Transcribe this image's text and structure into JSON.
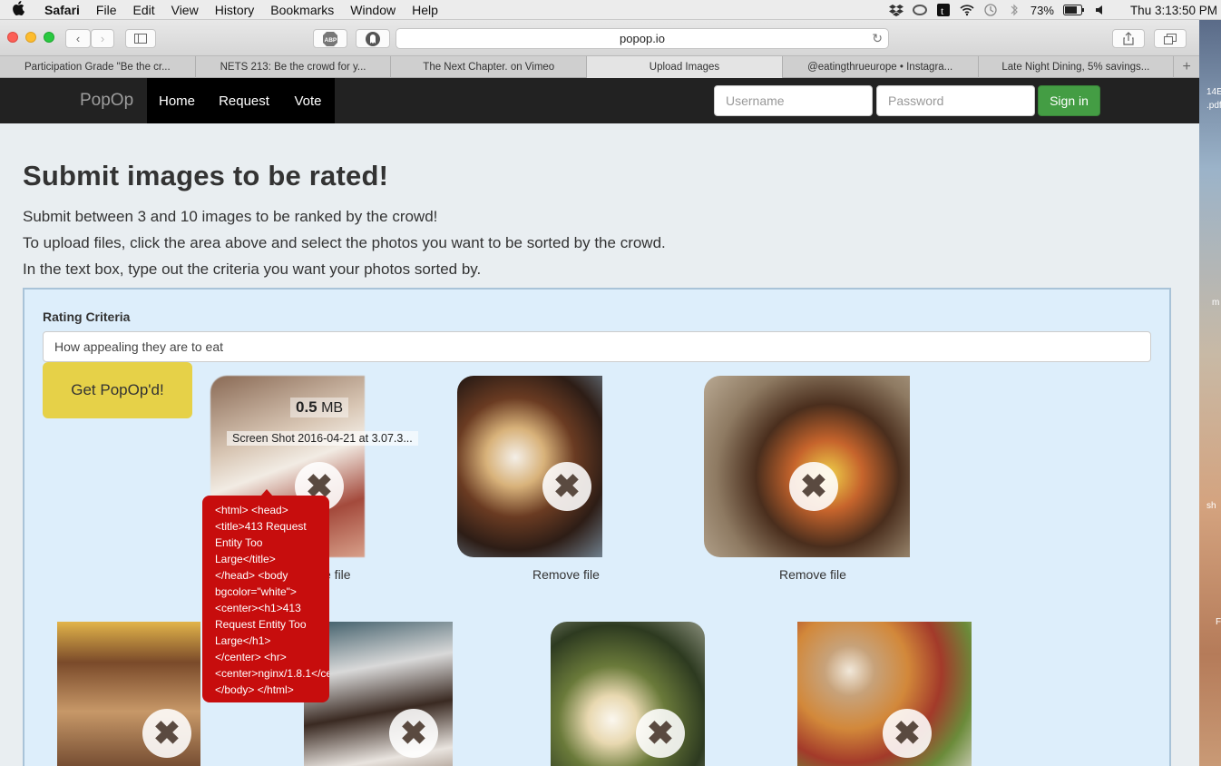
{
  "menubar": {
    "apple": "",
    "items": [
      "Safari",
      "File",
      "Edit",
      "View",
      "History",
      "Bookmarks",
      "Window",
      "Help"
    ],
    "battery": "73%",
    "clock": "Thu 3:13:50 PM"
  },
  "browser": {
    "url": "popop.io",
    "tabs": [
      "Participation Grade \"Be the cr...",
      "NETS 213: Be the crowd for y...",
      "The Next Chapter. on Vimeo",
      "Upload Images",
      "@eatingthrueurope • Instagra...",
      "Late Night Dining, 5% savings..."
    ],
    "active_tab_index": 3
  },
  "navbar": {
    "brand": "PopOp",
    "links": [
      "Home",
      "Request",
      "Vote"
    ],
    "username_placeholder": "Username",
    "password_placeholder": "Password",
    "signin_label": "Sign in"
  },
  "page": {
    "title": "Submit images to be rated!",
    "instructions": [
      "Submit between 3 and 10 images to be ranked by the crowd!",
      "To upload files, click the area above and select the photos you want to be sorted by the crowd.",
      "In the text box, type out the criteria you want your photos sorted by."
    ],
    "criteria_label": "Rating Criteria",
    "criteria_value": "How appealing they are to eat",
    "submit_label": "Get PopOp'd!",
    "remove_label": "Remove file",
    "remove_label_partial": "e file",
    "remove_glyph": "✖",
    "file1": {
      "size_value": "0.5",
      "size_unit": " MB",
      "name": "Screen Shot 2016-04-21 at 3.07.3..."
    },
    "error_message": "<html> <head> <title>413 Request Entity Too Large</title> </head> <body bgcolor=\"white\"> <center><h1>413 Request Entity Too Large</h1> </center> <hr> <center>nginx/1.8.1</center> </body> </html>"
  },
  "desktop": {
    "labels": [
      "14E-",
      ".pdf",
      "m",
      "sh",
      "F"
    ]
  },
  "colors": {
    "navbar_bg": "#222222",
    "signin_green": "#449d44",
    "submit_yellow": "#e6d148",
    "error_red": "#c70d0d",
    "dropzone_bg": "#ddeefb"
  }
}
